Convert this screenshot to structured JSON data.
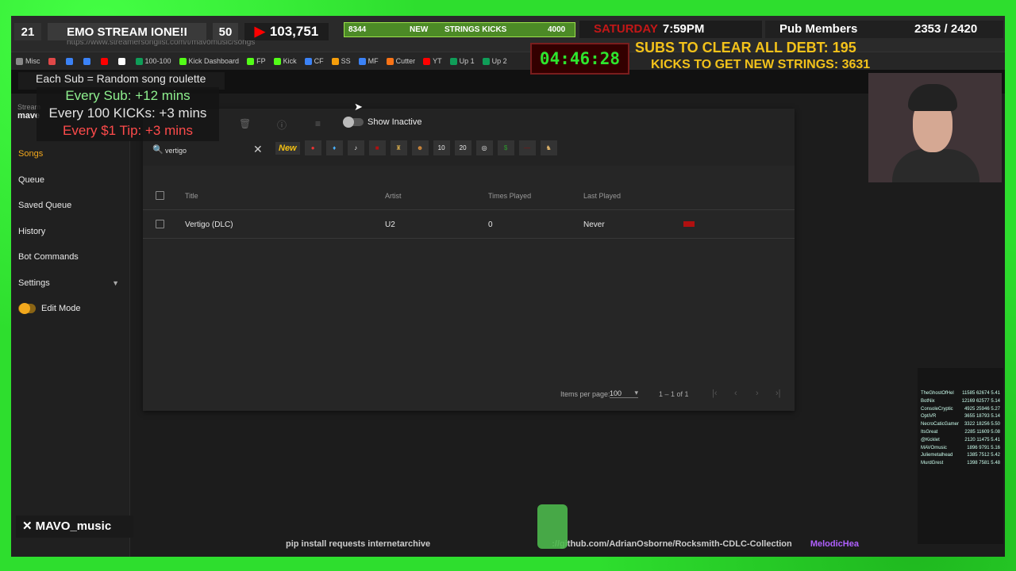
{
  "overlay": {
    "count_left": "21",
    "stream_title": "EMO STREAM IONE!I",
    "sub_count": "50",
    "youtube_views": "103,751",
    "strings_left": "8344",
    "strings_mid": "NEW",
    "strings_label": "STRINGS KICKS",
    "strings_goal": "4000",
    "day": "SATURDAY",
    "time": "7:59PM",
    "pub_label": "Pub Members",
    "pub_count": "2353 / 2420",
    "timer": "04:46:28",
    "debt": "SUBS TO CLEAR ALL DEBT: 195",
    "kicks": "KICKS TO GET NEW STRINGS: 3631",
    "sub_roulette": "Each Sub = Random song roulette",
    "rules": [
      "Every Sub: +12 mins",
      "Every 100 KICKs: +3 mins",
      "Every $1 Tip: +3 mins"
    ],
    "x_handle": "MAVO_music",
    "ticker": "pip install requests internetarchive",
    "ticker2": "://github.com/AdrianOsborne/Rocksmith-CDLC-Collection",
    "ticker3": "MelodicHea",
    "leaderboard": [
      {
        "name": "TheGhostOfHel",
        "v": "11585 62674 5.41"
      },
      {
        "name": "BotNix",
        "v": "12169 62577 5.14"
      },
      {
        "name": "ConsoleCryptic",
        "v": "4925 25946 5.27"
      },
      {
        "name": "OptiVR",
        "v": "3655 18793 5.14"
      },
      {
        "name": "NecroCaticGamer",
        "v": "3322 18256 5.50"
      },
      {
        "name": "ItsGreat",
        "v": "2285 11609 5.08"
      },
      {
        "name": "@Kicklet",
        "v": "2120 11475 5.41"
      },
      {
        "name": "MAVOmusic",
        "v": "1896 9791 5.16"
      },
      {
        "name": "Juliemetalhead",
        "v": "1385 7512 5.42"
      },
      {
        "name": "MurdGrest",
        "v": "1398 7581 5.48"
      }
    ]
  },
  "browser": {
    "url": "https://www.streamersonglist.com/t/mavomusic/songs",
    "bookmarks": [
      {
        "label": "Misc",
        "color": "#888888"
      },
      {
        "label": "",
        "color": "#e04848"
      },
      {
        "label": "",
        "color": "#3b82f6"
      },
      {
        "label": "",
        "color": "#3b82f6"
      },
      {
        "label": "",
        "color": "#ff0000"
      },
      {
        "label": "",
        "color": "#ffffff"
      },
      {
        "label": "100-100",
        "color": "#0f9d58"
      },
      {
        "label": "Kick Dashboard",
        "color": "#53fc18"
      },
      {
        "label": "FP",
        "color": "#53fc18"
      },
      {
        "label": "Kick",
        "color": "#53fc18"
      },
      {
        "label": "CF",
        "color": "#3b82f6"
      },
      {
        "label": "SS",
        "color": "#f59e0b"
      },
      {
        "label": "MF",
        "color": "#3b82f6"
      },
      {
        "label": "Cutter",
        "color": "#f97316"
      },
      {
        "label": "YT",
        "color": "#ff0000"
      },
      {
        "label": "Up 1",
        "color": "#0f9d58"
      },
      {
        "label": "Up 2",
        "color": "#0f9d58"
      }
    ]
  },
  "sidebar": {
    "header_small": "Stream",
    "header_name": "mave",
    "items": [
      {
        "label": "Songs",
        "active": true
      },
      {
        "label": "Queue"
      },
      {
        "label": "Saved Queue"
      },
      {
        "label": "History"
      },
      {
        "label": "Bot Commands"
      },
      {
        "label": "Settings"
      }
    ],
    "edit_mode": "Edit Mode"
  },
  "toolbar": {
    "show_inactive": "Show Inactive",
    "search_value": "vertigo",
    "new_filter": "New"
  },
  "table": {
    "columns": [
      "Title",
      "Artist",
      "Times Played",
      "Last Played"
    ],
    "rows": [
      {
        "title": "Vertigo (DLC)",
        "artist": "U2",
        "times_played": "0",
        "last_played": "Never"
      }
    ]
  },
  "paginator": {
    "items_per_page_label": "Items per page:",
    "items_per_page": "100",
    "range": "1 – 1 of 1"
  },
  "colors": {
    "accent": "#f3a81c",
    "green_screen": "#2ede2e"
  }
}
